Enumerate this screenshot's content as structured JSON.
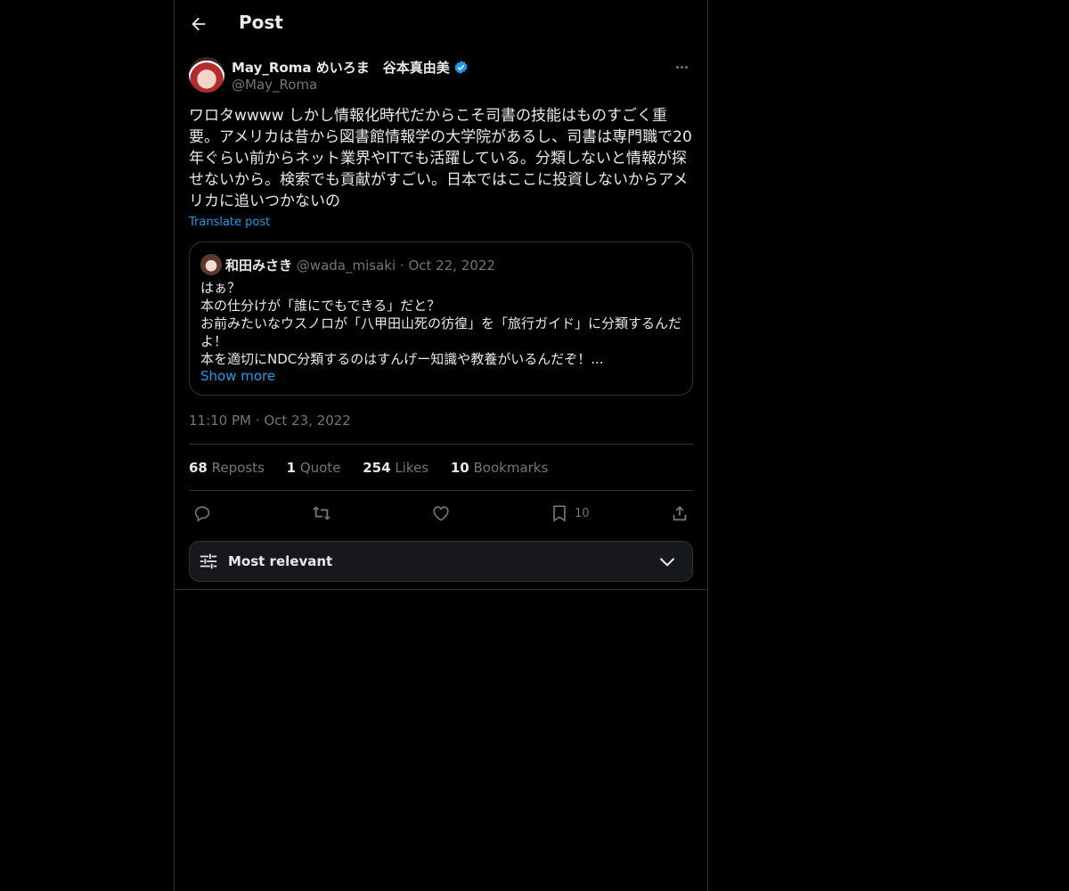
{
  "header": {
    "title": "Post"
  },
  "post": {
    "display_name": "May_Roma めいろま　谷本真由美",
    "handle": "@May_Roma",
    "text": "ワロタwwww しかし情報化時代だからこそ司書の技能はものすごく重要。アメリカは昔から図書館情報学の大学院があるし、司書は専門職で20年ぐらい前からネット業界やITでも活躍している。分類しないと情報が探せないから。検索でも貢献がすごい。日本ではここに投資しないからアメリカに追いつかないの",
    "translate_label": "Translate post",
    "time": "11:10 PM",
    "date": "Oct 23, 2022",
    "separator": "·"
  },
  "quote": {
    "display_name": "和田みさき",
    "handle": "@wada_misaki",
    "separator": "·",
    "date": "Oct 22, 2022",
    "text": "はぁ？\n本の仕分けが「誰にでもできる」だと？\nお前みたいなウスノロが「八甲田山死の彷徨」を「旅行ガイド」に分類するんだよ！\n本を適切にNDC分類するのはすんげー知識や教養がいるんだぞ！...",
    "show_more": "Show more"
  },
  "stats": {
    "reposts_count": "68",
    "reposts_label": "Reposts",
    "quotes_count": "1",
    "quotes_label": "Quote",
    "likes_count": "254",
    "likes_label": "Likes",
    "bookmarks_count": "10",
    "bookmarks_label": "Bookmarks"
  },
  "actions": {
    "bookmark_count": "10",
    "icons": [
      "reply-icon",
      "repost-icon",
      "like-icon",
      "bookmark-icon",
      "share-icon"
    ]
  },
  "sort": {
    "label": "Most relevant"
  },
  "colors": {
    "background": "#000000",
    "text": "#e7e9ea",
    "muted": "#71767b",
    "accent": "#1d9bf0",
    "border": "#2f3336"
  }
}
